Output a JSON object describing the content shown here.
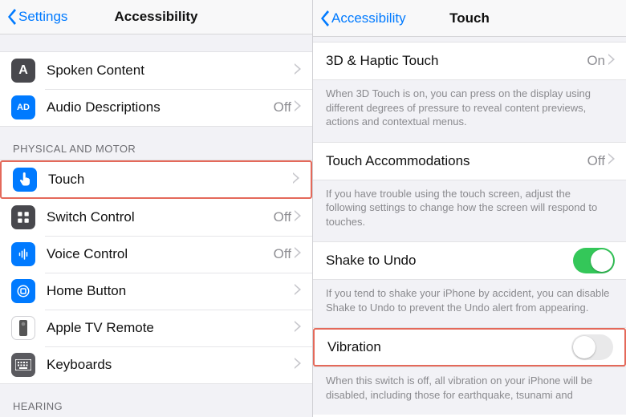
{
  "left": {
    "nav": {
      "back": "Settings",
      "title": "Accessibility"
    },
    "group_spoken": [
      {
        "label": "Spoken Content",
        "value": "",
        "icon": "a-icon"
      },
      {
        "label": "Audio Descriptions",
        "value": "Off",
        "icon": "ad-icon"
      }
    ],
    "section_physical": "PHYSICAL AND MOTOR",
    "group_physical": [
      {
        "label": "Touch",
        "value": "",
        "icon": "touch-icon",
        "highlight": true
      },
      {
        "label": "Switch Control",
        "value": "Off",
        "icon": "switch-control-icon"
      },
      {
        "label": "Voice Control",
        "value": "Off",
        "icon": "voice-control-icon"
      },
      {
        "label": "Home Button",
        "value": "",
        "icon": "home-button-icon"
      },
      {
        "label": "Apple TV Remote",
        "value": "",
        "icon": "apple-tv-remote-icon"
      },
      {
        "label": "Keyboards",
        "value": "",
        "icon": "keyboards-icon"
      }
    ],
    "section_hearing": "HEARING"
  },
  "right": {
    "nav": {
      "back": "Accessibility",
      "title": "Touch"
    },
    "row_3d": {
      "label": "3D & Haptic Touch",
      "value": "On"
    },
    "footer_3d": "When 3D Touch is on, you can press on the display using different degrees of pressure to reveal content previews, actions and contextual menus.",
    "row_accom": {
      "label": "Touch Accommodations",
      "value": "Off"
    },
    "footer_accom": "If you have trouble using the touch screen, adjust the following settings to change how the screen will respond to touches.",
    "row_shake": {
      "label": "Shake to Undo",
      "on": true
    },
    "footer_shake": "If you tend to shake your iPhone by accident, you can disable Shake to Undo to prevent the Undo alert from appearing.",
    "row_vibration": {
      "label": "Vibration",
      "on": false,
      "highlight": true
    },
    "footer_vibration": "When this switch is off, all vibration on your iPhone will be disabled, including those for earthquake, tsunami and"
  }
}
